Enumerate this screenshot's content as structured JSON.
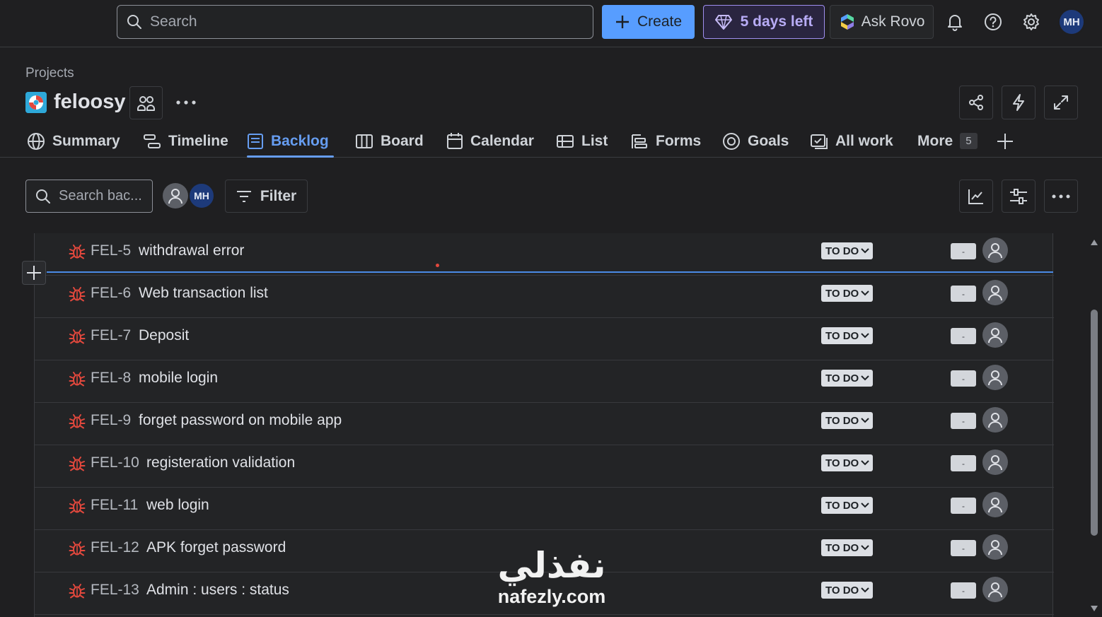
{
  "topbar": {
    "search_placeholder": "Search",
    "create_label": "Create",
    "trial_label": "5 days left",
    "rovo_label": "Ask Rovo",
    "user_initials": "MH"
  },
  "project": {
    "breadcrumb": "Projects",
    "name": "feloosy"
  },
  "tabs": [
    {
      "label": "Summary",
      "icon": "globe-icon"
    },
    {
      "label": "Timeline",
      "icon": "timeline-icon"
    },
    {
      "label": "Backlog",
      "icon": "backlog-icon",
      "active": true
    },
    {
      "label": "Board",
      "icon": "board-icon"
    },
    {
      "label": "Calendar",
      "icon": "calendar-icon"
    },
    {
      "label": "List",
      "icon": "list-icon"
    },
    {
      "label": "Forms",
      "icon": "forms-icon"
    },
    {
      "label": "Goals",
      "icon": "goals-icon"
    },
    {
      "label": "All work",
      "icon": "all-work-icon"
    },
    {
      "label": "More",
      "count": "5"
    }
  ],
  "backlog": {
    "search_placeholder": "Search bac...",
    "assignee_initials": "MH",
    "filter_label": "Filter"
  },
  "issues": [
    {
      "key": "FEL-5",
      "summary": "withdrawal error",
      "status": "TO DO",
      "estimate": "-"
    },
    {
      "key": "FEL-6",
      "summary": "Web transaction list",
      "status": "TO DO",
      "estimate": "-"
    },
    {
      "key": "FEL-7",
      "summary": "Deposit",
      "status": "TO DO",
      "estimate": "-"
    },
    {
      "key": "FEL-8",
      "summary": "mobile login",
      "status": "TO DO",
      "estimate": "-"
    },
    {
      "key": "FEL-9",
      "summary": "forget password on mobile app",
      "status": "TO DO",
      "estimate": "-"
    },
    {
      "key": "FEL-10",
      "summary": "registeration validation",
      "status": "TO DO",
      "estimate": "-"
    },
    {
      "key": "FEL-11",
      "summary": "web login",
      "status": "TO DO",
      "estimate": "-"
    },
    {
      "key": "FEL-12",
      "summary": "APK forget password",
      "status": "TO DO",
      "estimate": "-"
    },
    {
      "key": "FEL-13",
      "summary": "Admin : users : status",
      "status": "TO DO",
      "estimate": "-"
    }
  ],
  "watermark": {
    "arabic": "نفذلي",
    "site": "nafezly.com"
  },
  "colors": {
    "accent": "#579dff",
    "bug": "#e2483d",
    "trial": "#9f8fef"
  }
}
